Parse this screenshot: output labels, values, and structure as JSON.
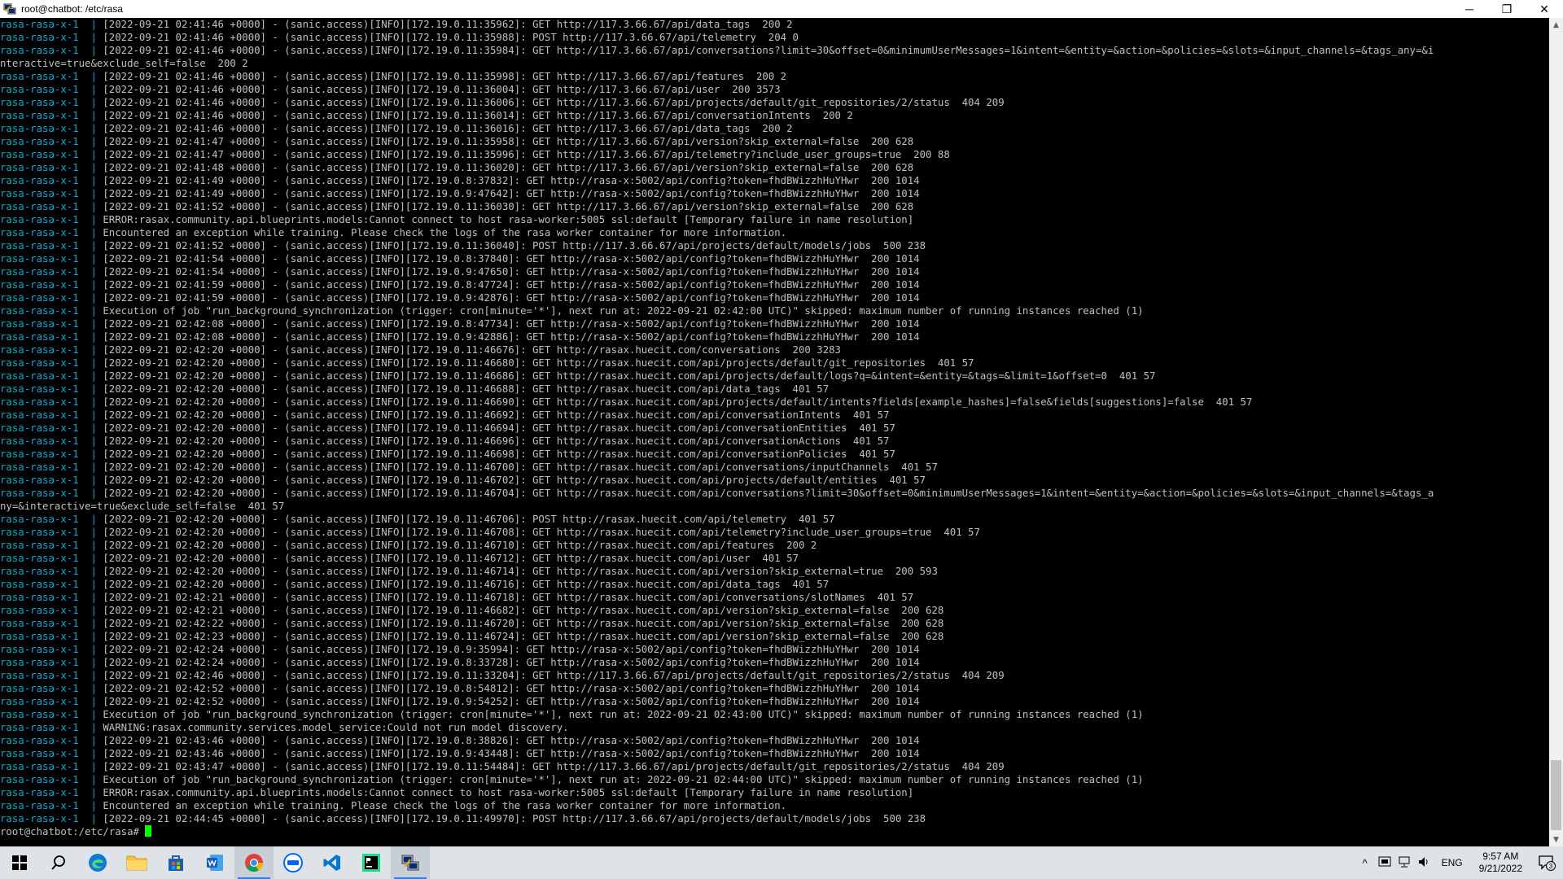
{
  "window": {
    "title": "root@chatbot: /etc/rasa",
    "controls": {
      "minimize": "─",
      "maximize": "❐",
      "close": "✕"
    }
  },
  "terminal": {
    "service_prefix": "rasa-rasa-x-1  |",
    "lines": [
      {
        "svc": true,
        "text": " [2022-09-21 02:41:46 +0000] - (sanic.access)[INFO][172.19.0.11:35962]: GET http://117.3.66.67/api/data_tags  200 2"
      },
      {
        "svc": true,
        "text": " [2022-09-21 02:41:46 +0000] - (sanic.access)[INFO][172.19.0.11:35988]: POST http://117.3.66.67/api/telemetry  204 0"
      },
      {
        "svc": true,
        "text": " [2022-09-21 02:41:46 +0000] - (sanic.access)[INFO][172.19.0.11:35984]: GET http://117.3.66.67/api/conversations?limit=30&offset=0&minimumUserMessages=1&intent=&entity=&action=&policies=&slots=&input_channels=&tags_any=&i"
      },
      {
        "svc": false,
        "text": "nteractive=true&exclude_self=false  200 2"
      },
      {
        "svc": true,
        "text": " [2022-09-21 02:41:46 +0000] - (sanic.access)[INFO][172.19.0.11:35998]: GET http://117.3.66.67/api/features  200 2"
      },
      {
        "svc": true,
        "text": " [2022-09-21 02:41:46 +0000] - (sanic.access)[INFO][172.19.0.11:36004]: GET http://117.3.66.67/api/user  200 3573"
      },
      {
        "svc": true,
        "text": " [2022-09-21 02:41:46 +0000] - (sanic.access)[INFO][172.19.0.11:36006]: GET http://117.3.66.67/api/projects/default/git_repositories/2/status  404 209"
      },
      {
        "svc": true,
        "text": " [2022-09-21 02:41:46 +0000] - (sanic.access)[INFO][172.19.0.11:36014]: GET http://117.3.66.67/api/conversationIntents  200 2"
      },
      {
        "svc": true,
        "text": " [2022-09-21 02:41:46 +0000] - (sanic.access)[INFO][172.19.0.11:36016]: GET http://117.3.66.67/api/data_tags  200 2"
      },
      {
        "svc": true,
        "text": " [2022-09-21 02:41:47 +0000] - (sanic.access)[INFO][172.19.0.11:35958]: GET http://117.3.66.67/api/version?skip_external=false  200 628"
      },
      {
        "svc": true,
        "text": " [2022-09-21 02:41:47 +0000] - (sanic.access)[INFO][172.19.0.11:35996]: GET http://117.3.66.67/api/telemetry?include_user_groups=true  200 88"
      },
      {
        "svc": true,
        "text": " [2022-09-21 02:41:48 +0000] - (sanic.access)[INFO][172.19.0.11:36020]: GET http://117.3.66.67/api/version?skip_external=false  200 628"
      },
      {
        "svc": true,
        "text": " [2022-09-21 02:41:49 +0000] - (sanic.access)[INFO][172.19.0.8:37832]: GET http://rasa-x:5002/api/config?token=fhdBWizzhHuYHwr  200 1014"
      },
      {
        "svc": true,
        "text": " [2022-09-21 02:41:49 +0000] - (sanic.access)[INFO][172.19.0.9:47642]: GET http://rasa-x:5002/api/config?token=fhdBWizzhHuYHwr  200 1014"
      },
      {
        "svc": true,
        "text": " [2022-09-21 02:41:52 +0000] - (sanic.access)[INFO][172.19.0.11:36030]: GET http://117.3.66.67/api/version?skip_external=false  200 628"
      },
      {
        "svc": true,
        "text": " ERROR:rasax.community.api.blueprints.models:Cannot connect to host rasa-worker:5005 ssl:default [Temporary failure in name resolution]"
      },
      {
        "svc": true,
        "text": " Encountered an exception while training. Please check the logs of the rasa worker container for more information."
      },
      {
        "svc": true,
        "text": " [2022-09-21 02:41:52 +0000] - (sanic.access)[INFO][172.19.0.11:36040]: POST http://117.3.66.67/api/projects/default/models/jobs  500 238"
      },
      {
        "svc": true,
        "text": " [2022-09-21 02:41:54 +0000] - (sanic.access)[INFO][172.19.0.8:37840]: GET http://rasa-x:5002/api/config?token=fhdBWizzhHuYHwr  200 1014"
      },
      {
        "svc": true,
        "text": " [2022-09-21 02:41:54 +0000] - (sanic.access)[INFO][172.19.0.9:47650]: GET http://rasa-x:5002/api/config?token=fhdBWizzhHuYHwr  200 1014"
      },
      {
        "svc": true,
        "text": " [2022-09-21 02:41:59 +0000] - (sanic.access)[INFO][172.19.0.8:47724]: GET http://rasa-x:5002/api/config?token=fhdBWizzhHuYHwr  200 1014"
      },
      {
        "svc": true,
        "text": " [2022-09-21 02:41:59 +0000] - (sanic.access)[INFO][172.19.0.9:42876]: GET http://rasa-x:5002/api/config?token=fhdBWizzhHuYHwr  200 1014"
      },
      {
        "svc": true,
        "text": " Execution of job \"run_background_synchronization (trigger: cron[minute='*'], next run at: 2022-09-21 02:42:00 UTC)\" skipped: maximum number of running instances reached (1)"
      },
      {
        "svc": true,
        "text": " [2022-09-21 02:42:08 +0000] - (sanic.access)[INFO][172.19.0.8:47734]: GET http://rasa-x:5002/api/config?token=fhdBWizzhHuYHwr  200 1014"
      },
      {
        "svc": true,
        "text": " [2022-09-21 02:42:08 +0000] - (sanic.access)[INFO][172.19.0.9:42886]: GET http://rasa-x:5002/api/config?token=fhdBWizzhHuYHwr  200 1014"
      },
      {
        "svc": true,
        "text": " [2022-09-21 02:42:20 +0000] - (sanic.access)[INFO][172.19.0.11:46676]: GET http://rasax.huecit.com/conversations  200 3283"
      },
      {
        "svc": true,
        "text": " [2022-09-21 02:42:20 +0000] - (sanic.access)[INFO][172.19.0.11:46680]: GET http://rasax.huecit.com/api/projects/default/git_repositories  401 57"
      },
      {
        "svc": true,
        "text": " [2022-09-21 02:42:20 +0000] - (sanic.access)[INFO][172.19.0.11:46686]: GET http://rasax.huecit.com/api/projects/default/logs?q=&intent=&entity=&tags=&limit=1&offset=0  401 57"
      },
      {
        "svc": true,
        "text": " [2022-09-21 02:42:20 +0000] - (sanic.access)[INFO][172.19.0.11:46688]: GET http://rasax.huecit.com/api/data_tags  401 57"
      },
      {
        "svc": true,
        "text": " [2022-09-21 02:42:20 +0000] - (sanic.access)[INFO][172.19.0.11:46690]: GET http://rasax.huecit.com/api/projects/default/intents?fields[example_hashes]=false&fields[suggestions]=false  401 57"
      },
      {
        "svc": true,
        "text": " [2022-09-21 02:42:20 +0000] - (sanic.access)[INFO][172.19.0.11:46692]: GET http://rasax.huecit.com/api/conversationIntents  401 57"
      },
      {
        "svc": true,
        "text": " [2022-09-21 02:42:20 +0000] - (sanic.access)[INFO][172.19.0.11:46694]: GET http://rasax.huecit.com/api/conversationEntities  401 57"
      },
      {
        "svc": true,
        "text": " [2022-09-21 02:42:20 +0000] - (sanic.access)[INFO][172.19.0.11:46696]: GET http://rasax.huecit.com/api/conversationActions  401 57"
      },
      {
        "svc": true,
        "text": " [2022-09-21 02:42:20 +0000] - (sanic.access)[INFO][172.19.0.11:46698]: GET http://rasax.huecit.com/api/conversationPolicies  401 57"
      },
      {
        "svc": true,
        "text": " [2022-09-21 02:42:20 +0000] - (sanic.access)[INFO][172.19.0.11:46700]: GET http://rasax.huecit.com/api/conversations/inputChannels  401 57"
      },
      {
        "svc": true,
        "text": " [2022-09-21 02:42:20 +0000] - (sanic.access)[INFO][172.19.0.11:46702]: GET http://rasax.huecit.com/api/projects/default/entities  401 57"
      },
      {
        "svc": true,
        "text": " [2022-09-21 02:42:20 +0000] - (sanic.access)[INFO][172.19.0.11:46704]: GET http://rasax.huecit.com/api/conversations?limit=30&offset=0&minimumUserMessages=1&intent=&entity=&action=&policies=&slots=&input_channels=&tags_a"
      },
      {
        "svc": false,
        "text": "ny=&interactive=true&exclude_self=false  401 57"
      },
      {
        "svc": true,
        "text": " [2022-09-21 02:42:20 +0000] - (sanic.access)[INFO][172.19.0.11:46706]: POST http://rasax.huecit.com/api/telemetry  401 57"
      },
      {
        "svc": true,
        "text": " [2022-09-21 02:42:20 +0000] - (sanic.access)[INFO][172.19.0.11:46708]: GET http://rasax.huecit.com/api/telemetry?include_user_groups=true  401 57"
      },
      {
        "svc": true,
        "text": " [2022-09-21 02:42:20 +0000] - (sanic.access)[INFO][172.19.0.11:46710]: GET http://rasax.huecit.com/api/features  200 2"
      },
      {
        "svc": true,
        "text": " [2022-09-21 02:42:20 +0000] - (sanic.access)[INFO][172.19.0.11:46712]: GET http://rasax.huecit.com/api/user  401 57"
      },
      {
        "svc": true,
        "text": " [2022-09-21 02:42:20 +0000] - (sanic.access)[INFO][172.19.0.11:46714]: GET http://rasax.huecit.com/api/version?skip_external=true  200 593"
      },
      {
        "svc": true,
        "text": " [2022-09-21 02:42:20 +0000] - (sanic.access)[INFO][172.19.0.11:46716]: GET http://rasax.huecit.com/api/data_tags  401 57"
      },
      {
        "svc": true,
        "text": " [2022-09-21 02:42:21 +0000] - (sanic.access)[INFO][172.19.0.11:46718]: GET http://rasax.huecit.com/api/conversations/slotNames  401 57"
      },
      {
        "svc": true,
        "text": " [2022-09-21 02:42:21 +0000] - (sanic.access)[INFO][172.19.0.11:46682]: GET http://rasax.huecit.com/api/version?skip_external=false  200 628"
      },
      {
        "svc": true,
        "text": " [2022-09-21 02:42:22 +0000] - (sanic.access)[INFO][172.19.0.11:46720]: GET http://rasax.huecit.com/api/version?skip_external=false  200 628"
      },
      {
        "svc": true,
        "text": " [2022-09-21 02:42:23 +0000] - (sanic.access)[INFO][172.19.0.11:46724]: GET http://rasax.huecit.com/api/version?skip_external=false  200 628"
      },
      {
        "svc": true,
        "text": " [2022-09-21 02:42:24 +0000] - (sanic.access)[INFO][172.19.0.9:35994]: GET http://rasa-x:5002/api/config?token=fhdBWizzhHuYHwr  200 1014"
      },
      {
        "svc": true,
        "text": " [2022-09-21 02:42:24 +0000] - (sanic.access)[INFO][172.19.0.8:33728]: GET http://rasa-x:5002/api/config?token=fhdBWizzhHuYHwr  200 1014"
      },
      {
        "svc": true,
        "text": " [2022-09-21 02:42:46 +0000] - (sanic.access)[INFO][172.19.0.11:33204]: GET http://117.3.66.67/api/projects/default/git_repositories/2/status  404 209"
      },
      {
        "svc": true,
        "text": " [2022-09-21 02:42:52 +0000] - (sanic.access)[INFO][172.19.0.8:54812]: GET http://rasa-x:5002/api/config?token=fhdBWizzhHuYHwr  200 1014"
      },
      {
        "svc": true,
        "text": " [2022-09-21 02:42:52 +0000] - (sanic.access)[INFO][172.19.0.9:54252]: GET http://rasa-x:5002/api/config?token=fhdBWizzhHuYHwr  200 1014"
      },
      {
        "svc": true,
        "text": " Execution of job \"run_background_synchronization (trigger: cron[minute='*'], next run at: 2022-09-21 02:43:00 UTC)\" skipped: maximum number of running instances reached (1)"
      },
      {
        "svc": true,
        "text": " WARNING:rasax.community.services.model_service:Could not run model discovery."
      },
      {
        "svc": true,
        "text": " [2022-09-21 02:43:46 +0000] - (sanic.access)[INFO][172.19.0.8:38826]: GET http://rasa-x:5002/api/config?token=fhdBWizzhHuYHwr  200 1014"
      },
      {
        "svc": true,
        "text": " [2022-09-21 02:43:46 +0000] - (sanic.access)[INFO][172.19.0.9:43448]: GET http://rasa-x:5002/api/config?token=fhdBWizzhHuYHwr  200 1014"
      },
      {
        "svc": true,
        "text": " [2022-09-21 02:43:47 +0000] - (sanic.access)[INFO][172.19.0.11:54484]: GET http://117.3.66.67/api/projects/default/git_repositories/2/status  404 209"
      },
      {
        "svc": true,
        "text": " Execution of job \"run_background_synchronization (trigger: cron[minute='*'], next run at: 2022-09-21 02:44:00 UTC)\" skipped: maximum number of running instances reached (1)"
      },
      {
        "svc": true,
        "text": " ERROR:rasax.community.api.blueprints.models:Cannot connect to host rasa-worker:5005 ssl:default [Temporary failure in name resolution]"
      },
      {
        "svc": true,
        "text": " Encountered an exception while training. Please check the logs of the rasa worker container for more information."
      },
      {
        "svc": true,
        "text": " [2022-09-21 02:44:45 +0000] - (sanic.access)[INFO][172.19.0.11:49970]: POST http://117.3.66.67/api/projects/default/models/jobs  500 238"
      }
    ],
    "prompt": "root@chatbot:/etc/rasa# "
  },
  "scrollbar": {
    "up": "▲",
    "down": "▼"
  },
  "taskbar": {
    "tray": {
      "chevron": "^",
      "language": "ENG",
      "time": "9:57 AM",
      "date": "9/21/2022",
      "notifications": "3"
    }
  },
  "colors": {
    "service": "#11a8cd",
    "text": "#c0c0c0",
    "cursor": "#00ff00",
    "taskbar": "#dfe3e8"
  }
}
